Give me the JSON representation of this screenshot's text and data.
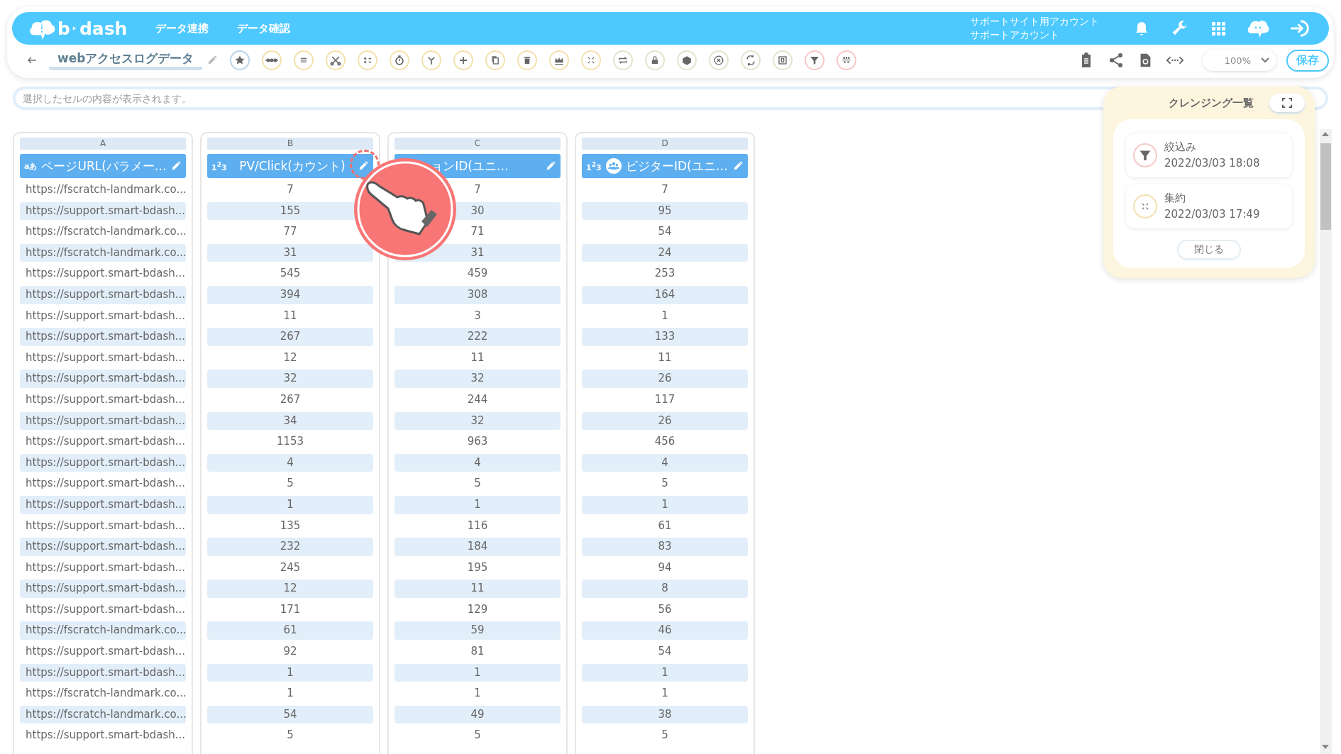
{
  "header": {
    "logo": {
      "left": "b",
      "right": "dash"
    },
    "nav": [
      {
        "label": "データ連携"
      },
      {
        "label": "データ確認"
      }
    ],
    "account": [
      "サポートサイト用アカウント",
      "サポートアカウント"
    ]
  },
  "toolbar": {
    "title": "webアクセスログデータ",
    "zoom": "100%",
    "save": "保存"
  },
  "cell_preview": {
    "placeholder": "選択したセルの内容が表示されます。"
  },
  "columns": [
    {
      "letter": "A",
      "kind": "text",
      "type_label": "aあ",
      "title": "ページURL(パラメー…",
      "highlighted": false
    },
    {
      "letter": "B",
      "kind": "number",
      "type_label": "1$^{2}$3",
      "title": "PV/Click(カウント)",
      "highlighted": true
    },
    {
      "letter": "C",
      "kind": "number",
      "title": "ョンID(ユニ…",
      "highlighted": false
    },
    {
      "letter": "D",
      "kind": "number",
      "type_label": "1$^{2}$3",
      "title": "ビジターID(ユニ…",
      "highlighted": false,
      "people": true
    }
  ],
  "rows": [
    [
      "https://fscratch-landmark.co...",
      "7",
      "7",
      "7"
    ],
    [
      "https://support.smart-bdash...",
      "155",
      "30",
      "95"
    ],
    [
      "https://fscratch-landmark.co...",
      "77",
      "71",
      "54"
    ],
    [
      "https://fscratch-landmark.co...",
      "31",
      "31",
      "24"
    ],
    [
      "https://support.smart-bdash...",
      "545",
      "459",
      "253"
    ],
    [
      "https://support.smart-bdash...",
      "394",
      "308",
      "164"
    ],
    [
      "https://support.smart-bdash...",
      "11",
      "3",
      "1"
    ],
    [
      "https://support.smart-bdash...",
      "267",
      "222",
      "133"
    ],
    [
      "https://support.smart-bdash...",
      "12",
      "11",
      "11"
    ],
    [
      "https://support.smart-bdash...",
      "32",
      "32",
      "26"
    ],
    [
      "https://support.smart-bdash...",
      "267",
      "244",
      "117"
    ],
    [
      "https://support.smart-bdash...",
      "34",
      "32",
      "26"
    ],
    [
      "https://support.smart-bdash...",
      "1153",
      "963",
      "456"
    ],
    [
      "https://support.smart-bdash...",
      "4",
      "4",
      "4"
    ],
    [
      "https://support.smart-bdash...",
      "5",
      "5",
      "5"
    ],
    [
      "https://support.smart-bdash...",
      "1",
      "1",
      "1"
    ],
    [
      "https://support.smart-bdash...",
      "135",
      "116",
      "61"
    ],
    [
      "https://support.smart-bdash...",
      "232",
      "184",
      "83"
    ],
    [
      "https://support.smart-bdash...",
      "245",
      "195",
      "94"
    ],
    [
      "https://support.smart-bdash...",
      "12",
      "11",
      "8"
    ],
    [
      "https://support.smart-bdash...",
      "171",
      "129",
      "56"
    ],
    [
      "https://fscratch-landmark.co...",
      "61",
      "59",
      "46"
    ],
    [
      "https://support.smart-bdash...",
      "92",
      "81",
      "54"
    ],
    [
      "https://support.smart-bdash...",
      "1",
      "1",
      "1"
    ],
    [
      "https://fscratch-landmark.co...",
      "1",
      "1",
      "1"
    ],
    [
      "https://fscratch-landmark.co...",
      "54",
      "49",
      "38"
    ],
    [
      "https://support.smart-bdash...",
      "5",
      "5",
      "5"
    ]
  ],
  "cleansing_panel": {
    "title": "クレンジング一覧",
    "items": [
      {
        "kind": "filter",
        "name": "絞込み",
        "date": "2022/03/03 18:08"
      },
      {
        "kind": "aggregate",
        "name": "集約",
        "date": "2022/03/03 17:49"
      }
    ],
    "close": "閉じる"
  }
}
